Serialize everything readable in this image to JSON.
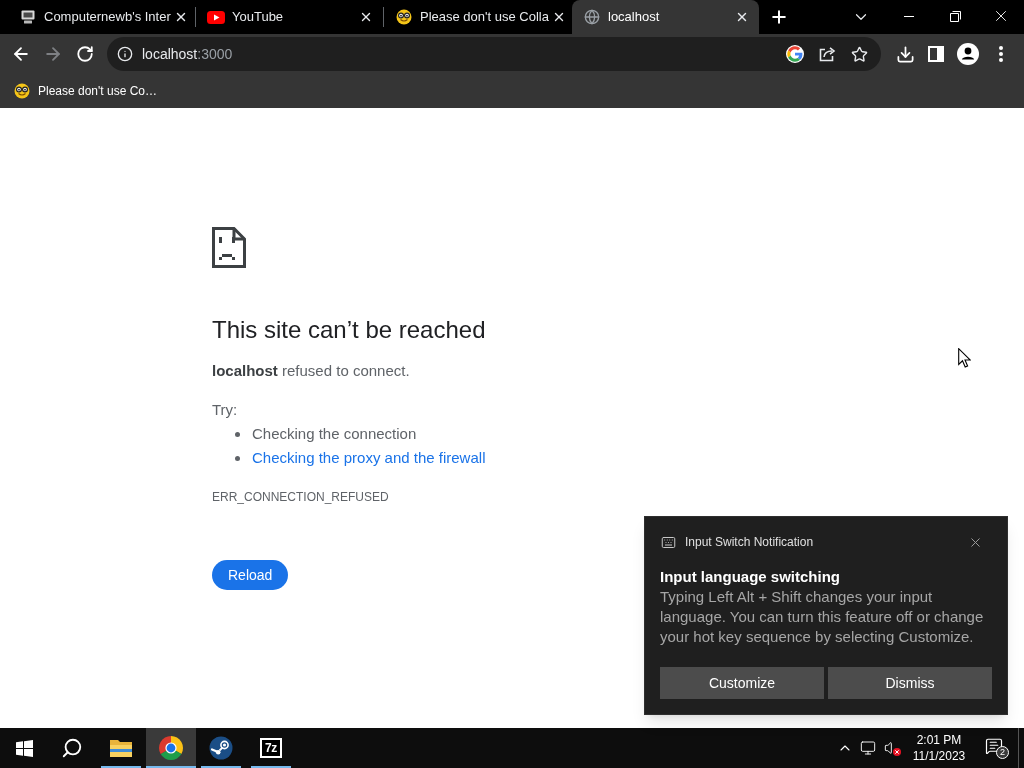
{
  "browser": {
    "tabs": [
      {
        "kind": "computer",
        "title": "Computernewb's Inter",
        "selected": false
      },
      {
        "kind": "video",
        "title": "YouTube",
        "selected": false
      },
      {
        "kind": "emoji",
        "title": "Please don't use Colla",
        "selected": false
      },
      {
        "kind": "globe",
        "title": "localhost",
        "selected": true
      }
    ],
    "nav_buttons": [
      {
        "kind": "back",
        "disabled": false
      },
      {
        "kind": "forward",
        "disabled": true
      },
      {
        "kind": "reload",
        "disabled": false
      }
    ],
    "address_bar": {
      "host": "localhost",
      "port": ":3000"
    },
    "bookmarks": [
      {
        "label": "Please don't use Co…"
      }
    ]
  },
  "page": {
    "heading": "This site can’t be reached",
    "message": "**localhost** refused to connect.",
    "try_label": "Try:",
    "suggestions": [
      {
        "kind": "text",
        "text": "Checking the connection"
      },
      {
        "kind": "link",
        "text": "Checking the proxy and the firewall"
      }
    ],
    "error_code": "ERR_CONNECTION_REFUSED",
    "reload_button": "Reload"
  },
  "notification": {
    "app": "Input Switch Notification",
    "title": "Input language switching",
    "body": "Typing Left Alt + Shift changes your input language. You can turn this feature off or change your hot key sequence by selecting Customize.",
    "buttons": [
      "Customize",
      "Dismiss"
    ]
  },
  "taskbar": {
    "apps": [
      {
        "kind": "folder",
        "running": true,
        "selected": false
      },
      {
        "kind": "browser",
        "running": true,
        "selected": true
      },
      {
        "kind": "steam",
        "running": true,
        "selected": false
      },
      {
        "kind": "archive",
        "label": "7z",
        "running": true,
        "selected": false
      }
    ],
    "volume_muted": true,
    "clock": {
      "time": "2:01 PM",
      "date": "11/1/2023"
    },
    "notification_count": "2"
  }
}
